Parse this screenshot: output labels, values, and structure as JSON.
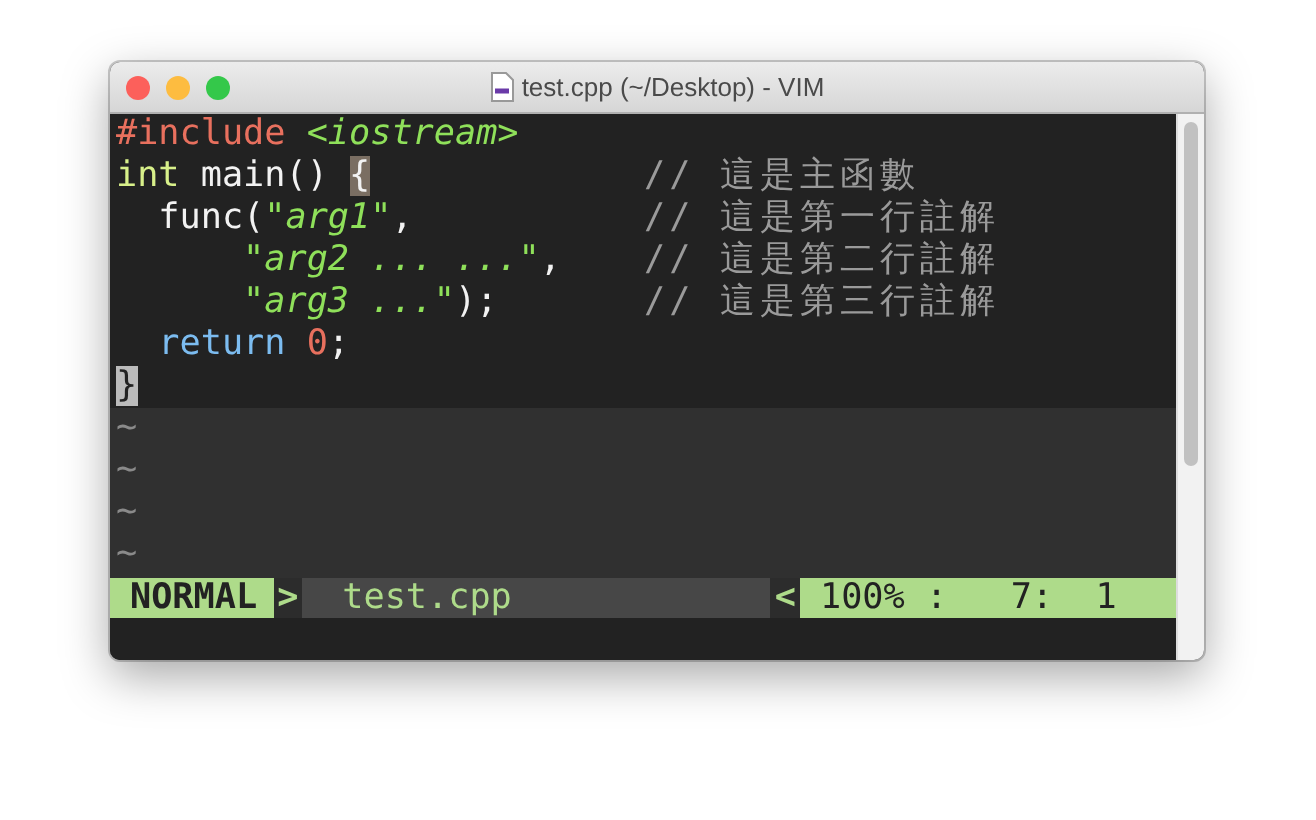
{
  "window": {
    "title": "test.cpp (~/Desktop) - VIM"
  },
  "lines": [
    {
      "code": [
        {
          "kind": "preproc",
          "text": "#include "
        },
        {
          "kind": "string",
          "text": "<iostream>"
        }
      ]
    },
    {
      "code": [
        {
          "kind": "type",
          "text": "int"
        },
        {
          "kind": "plain",
          "text": " main() "
        },
        {
          "kind": "match",
          "text": "{"
        }
      ],
      "comment": "// 這是主函數"
    },
    {
      "code": [
        {
          "kind": "plain",
          "text": "  func("
        },
        {
          "kind": "quote",
          "text": "\""
        },
        {
          "kind": "string",
          "text": "arg1"
        },
        {
          "kind": "quote",
          "text": "\""
        },
        {
          "kind": "plain",
          "text": ","
        }
      ],
      "comment": "// 這是第一行註解"
    },
    {
      "code": [
        {
          "kind": "quote",
          "text": "      \""
        },
        {
          "kind": "string",
          "text": "arg2 ... ..."
        },
        {
          "kind": "quote",
          "text": "\""
        },
        {
          "kind": "plain",
          "text": ","
        }
      ],
      "comment": "// 這是第二行註解"
    },
    {
      "code": [
        {
          "kind": "quote",
          "text": "      \""
        },
        {
          "kind": "string",
          "text": "arg3 ..."
        },
        {
          "kind": "quote",
          "text": "\""
        },
        {
          "kind": "plain",
          "text": ");"
        }
      ],
      "comment": "// 這是第三行註解"
    },
    {
      "code": [
        {
          "kind": "keyword",
          "text": "  return "
        },
        {
          "kind": "number",
          "text": "0"
        },
        {
          "kind": "plain",
          "text": ";"
        }
      ]
    },
    {
      "code": [
        {
          "kind": "cursor",
          "text": "}"
        }
      ]
    }
  ],
  "empty_lines": [
    "~",
    "~",
    "~",
    "~"
  ],
  "status_bar": {
    "mode": "NORMAL",
    "left_separator": ">",
    "file": "test.cpp",
    "right_separator": "<",
    "position": "100% :   7:  1"
  }
}
